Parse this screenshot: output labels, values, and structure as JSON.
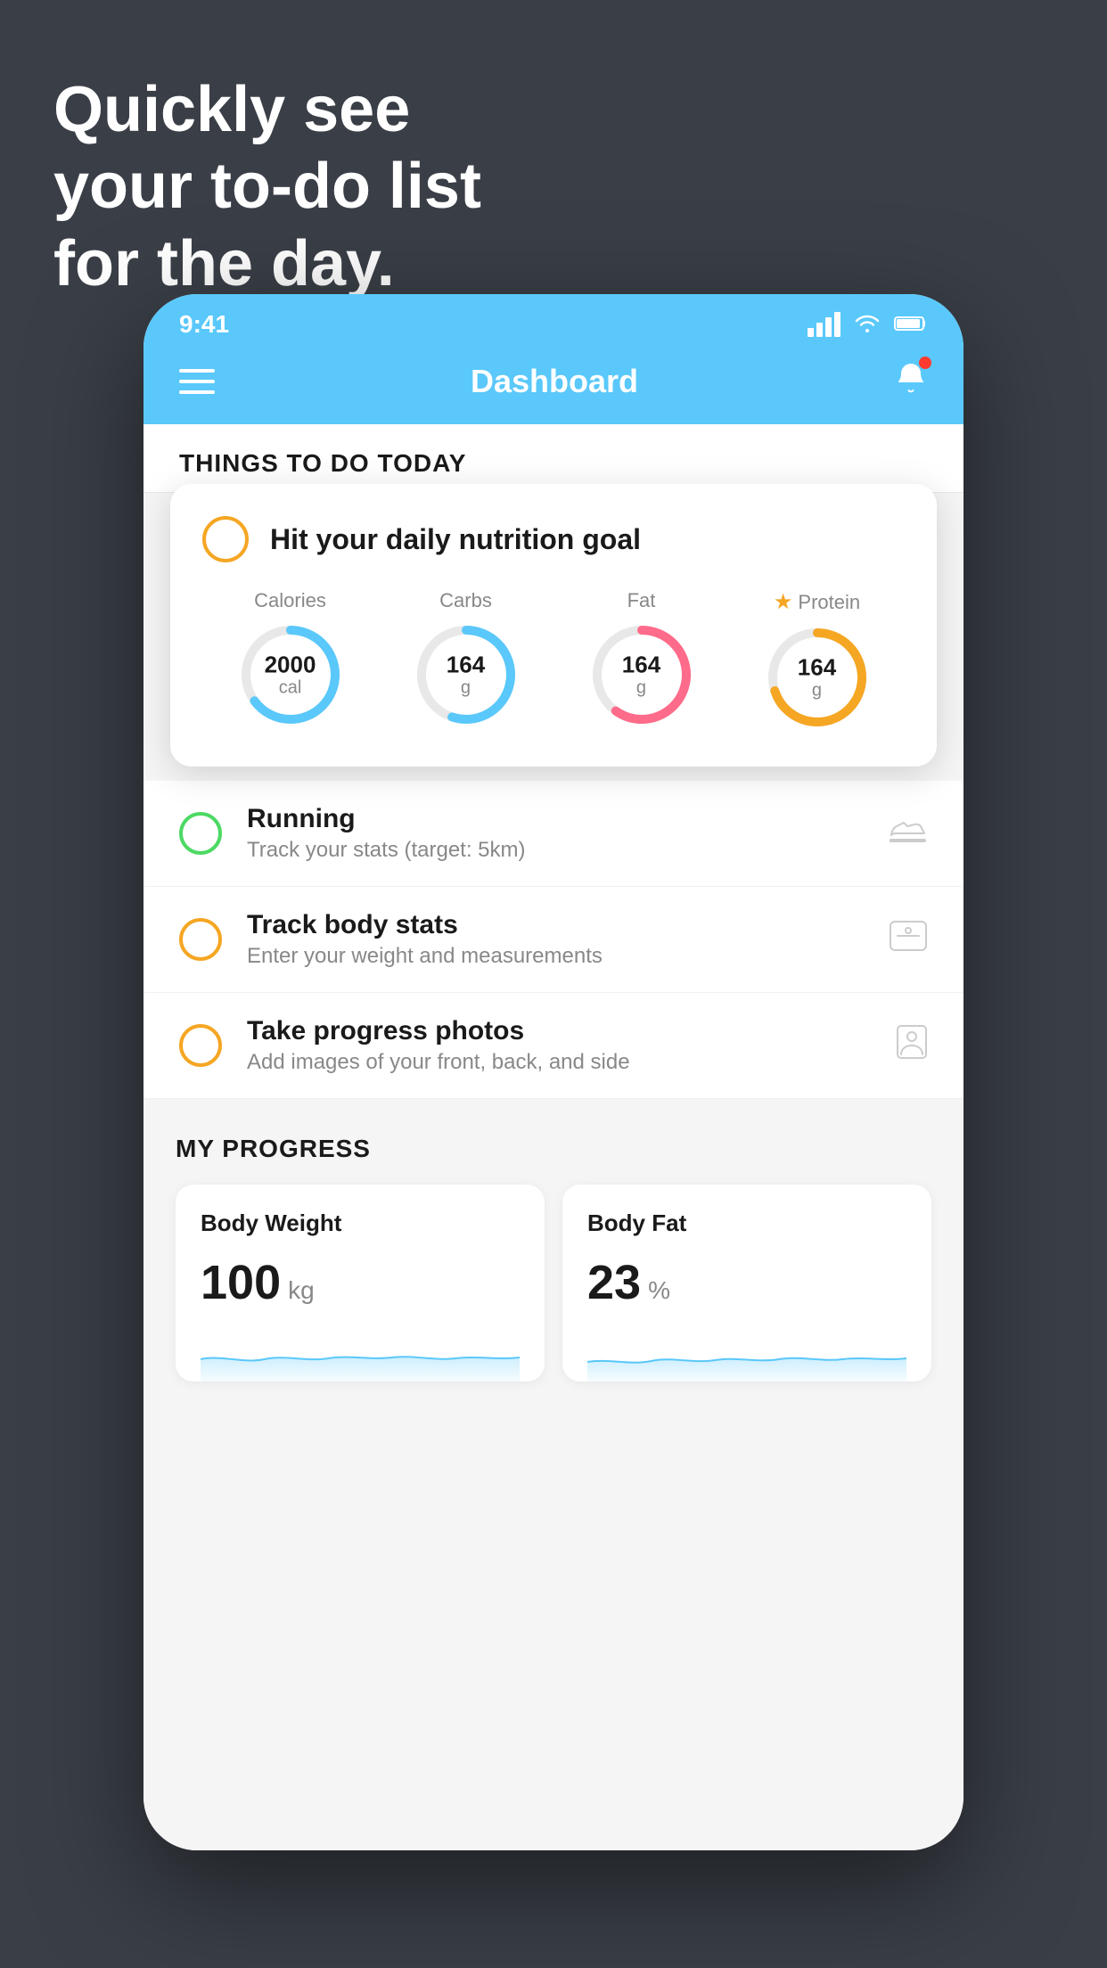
{
  "background": {
    "color": "#3a3f47"
  },
  "headline": {
    "line1": "Quickly see",
    "line2": "your to-do list",
    "line3": "for the day."
  },
  "status_bar": {
    "time": "9:41",
    "signal": "signal",
    "wifi": "wifi",
    "battery": "battery"
  },
  "nav": {
    "title": "Dashboard",
    "menu_label": "menu",
    "bell_label": "notifications"
  },
  "things_today": {
    "section_title": "THINGS TO DO TODAY"
  },
  "nutrition_card": {
    "todo_label": "Hit your daily nutrition goal",
    "macros": [
      {
        "label": "Calories",
        "value": "2000",
        "unit": "cal",
        "color": "#5ac8fa",
        "percent": 65,
        "starred": false
      },
      {
        "label": "Carbs",
        "value": "164",
        "unit": "g",
        "color": "#5ac8fa",
        "percent": 55,
        "starred": false
      },
      {
        "label": "Fat",
        "value": "164",
        "unit": "g",
        "color": "#ff6b8a",
        "percent": 60,
        "starred": false
      },
      {
        "label": "Protein",
        "value": "164",
        "unit": "g",
        "color": "#f5a623",
        "percent": 70,
        "starred": true
      }
    ]
  },
  "todo_items": [
    {
      "name": "Running",
      "desc": "Track your stats (target: 5km)",
      "circle_color": "green",
      "icon": "shoe"
    },
    {
      "name": "Track body stats",
      "desc": "Enter your weight and measurements",
      "circle_color": "yellow",
      "icon": "scale"
    },
    {
      "name": "Take progress photos",
      "desc": "Add images of your front, back, and side",
      "circle_color": "yellow",
      "icon": "person"
    }
  ],
  "progress": {
    "section_title": "MY PROGRESS",
    "cards": [
      {
        "title": "Body Weight",
        "value": "100",
        "unit": "kg"
      },
      {
        "title": "Body Fat",
        "value": "23",
        "unit": "%"
      }
    ]
  }
}
